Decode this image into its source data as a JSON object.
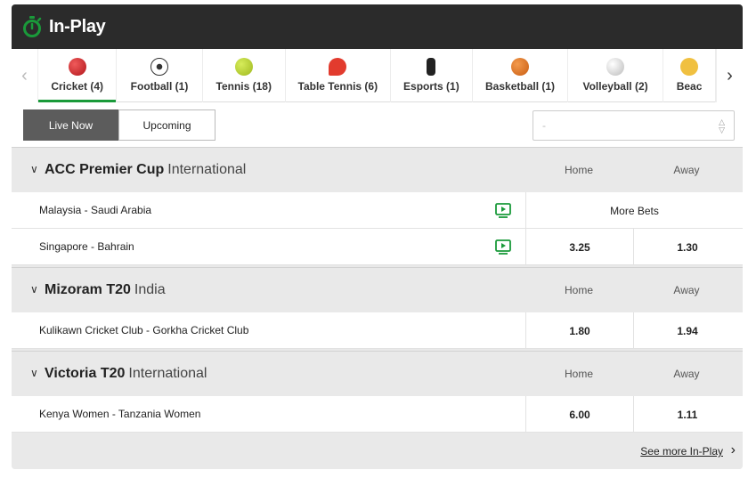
{
  "header": {
    "title": "In-Play",
    "icon": "stopwatch-icon",
    "accent": "#1a9a3a"
  },
  "sports_tabs": [
    {
      "label": "Cricket (4)",
      "icon": "cricket-ball-icon",
      "color": "#d3242b",
      "active": true,
      "width": 90
    },
    {
      "label": "Football (1)",
      "icon": "football-icon",
      "color": "#ffffff",
      "active": false,
      "width": 98
    },
    {
      "label": "Tennis (18)",
      "icon": "tennis-ball-icon",
      "color": "#b9d432",
      "active": false,
      "width": 95
    },
    {
      "label": "Table Tennis (6)",
      "icon": "table-tennis-icon",
      "color": "#e23b2e",
      "active": false,
      "width": 120
    },
    {
      "label": "Esports (1)",
      "icon": "esports-icon",
      "color": "#222222",
      "active": false,
      "width": 94
    },
    {
      "label": "Basketball (1)",
      "icon": "basketball-icon",
      "color": "#e8792b",
      "active": false,
      "width": 109
    },
    {
      "label": "Volleyball (2)",
      "icon": "volleyball-icon",
      "color": "#d9d9d9",
      "active": false,
      "width": 109
    },
    {
      "label": "Beac",
      "icon": "beach-volleyball-icon",
      "color": "#f0c040",
      "active": false,
      "width": 60
    }
  ],
  "filters": {
    "live_now": "Live Now",
    "upcoming": "Upcoming",
    "select_value": "-"
  },
  "leagues": [
    {
      "name": "ACC Premier Cup",
      "region": "International",
      "home_label": "Home",
      "away_label": "Away",
      "matches": [
        {
          "teams": "Malaysia  - Saudi Arabia",
          "tv": true,
          "more_bets": "More Bets"
        },
        {
          "teams": "Singapore  - Bahrain",
          "tv": true,
          "home": "3.25",
          "away": "1.30"
        }
      ]
    },
    {
      "name": "Mizoram T20",
      "region": "India",
      "home_label": "Home",
      "away_label": "Away",
      "matches": [
        {
          "teams": "Kulikawn Cricket Club  - Gorkha Cricket Club",
          "tv": false,
          "home": "1.80",
          "away": "1.94"
        }
      ]
    },
    {
      "name": "Victoria T20",
      "region": "International",
      "home_label": "Home",
      "away_label": "Away",
      "matches": [
        {
          "teams": "Kenya Women  - Tanzania Women",
          "tv": false,
          "home": "6.00",
          "away": "1.11"
        }
      ]
    }
  ],
  "footer": {
    "see_more": "See more In-Play"
  }
}
